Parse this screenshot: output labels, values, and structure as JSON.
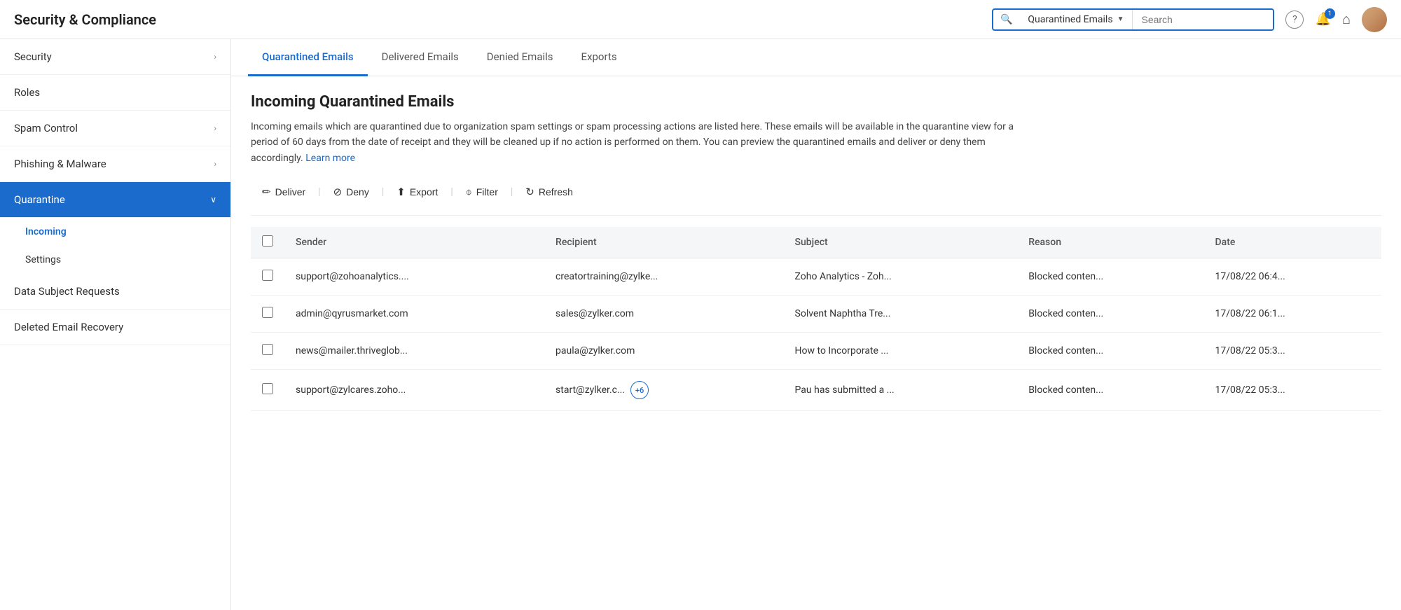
{
  "header": {
    "title": "Security & Compliance",
    "search": {
      "scope": "Quarantined Emails",
      "placeholder": "Search"
    },
    "notification_count": "1",
    "icons": {
      "help": "?",
      "bell": "🔔",
      "home": "⌂"
    }
  },
  "sidebar": {
    "items": [
      {
        "id": "security",
        "label": "Security",
        "hasChevron": true,
        "active": false
      },
      {
        "id": "roles",
        "label": "Roles",
        "hasChevron": false,
        "active": false
      },
      {
        "id": "spam-control",
        "label": "Spam Control",
        "hasChevron": true,
        "active": false
      },
      {
        "id": "phishing-malware",
        "label": "Phishing & Malware",
        "hasChevron": true,
        "active": false
      },
      {
        "id": "quarantine",
        "label": "Quarantine",
        "hasChevron": false,
        "active": true
      }
    ],
    "sub_items": [
      {
        "id": "incoming",
        "label": "Incoming",
        "active": true
      },
      {
        "id": "settings",
        "label": "Settings",
        "active": false
      }
    ],
    "bottom_items": [
      {
        "id": "data-subject",
        "label": "Data Subject Requests",
        "hasChevron": false,
        "active": false
      },
      {
        "id": "deleted-email",
        "label": "Deleted Email Recovery",
        "hasChevron": false,
        "active": false
      }
    ]
  },
  "tabs": [
    {
      "id": "quarantined",
      "label": "Quarantined Emails",
      "active": true
    },
    {
      "id": "delivered",
      "label": "Delivered Emails",
      "active": false
    },
    {
      "id": "denied",
      "label": "Denied Emails",
      "active": false
    },
    {
      "id": "exports",
      "label": "Exports",
      "active": false
    }
  ],
  "content": {
    "title": "Incoming Quarantined Emails",
    "description": "Incoming emails which are quarantined due to organization spam settings or spam processing actions are listed here. These emails will be available in the quarantine view for a period of 60 days from the date of receipt and they will be cleaned up if no action is performed on them. You can preview the quarantined emails and deliver or deny them accordingly.",
    "learn_more": "Learn more",
    "actions": [
      {
        "id": "deliver",
        "label": "Deliver",
        "icon": "✏"
      },
      {
        "id": "deny",
        "label": "Deny",
        "icon": "🚫"
      },
      {
        "id": "export",
        "label": "Export",
        "icon": "⬆"
      },
      {
        "id": "filter",
        "label": "Filter",
        "icon": "⌽"
      },
      {
        "id": "refresh",
        "label": "Refresh",
        "icon": "↻"
      }
    ],
    "table": {
      "columns": [
        "Sender",
        "Recipient",
        "Subject",
        "Reason",
        "Date"
      ],
      "rows": [
        {
          "sender": "support@zohoanalytics....",
          "recipient": "creatortraining@zylke...",
          "recipient_extra": null,
          "subject": "Zoho Analytics - Zoh...",
          "reason": "Blocked conten...",
          "date": "17/08/22 06:4..."
        },
        {
          "sender": "admin@qyrusmarket.com",
          "recipient": "sales@zylker.com",
          "recipient_extra": null,
          "subject": "Solvent Naphtha Tre...",
          "reason": "Blocked conten...",
          "date": "17/08/22 06:1..."
        },
        {
          "sender": "news@mailer.thriveglob...",
          "recipient": "paula@zylker.com",
          "recipient_extra": null,
          "subject": "How to Incorporate ...",
          "reason": "Blocked conten...",
          "date": "17/08/22 05:3..."
        },
        {
          "sender": "support@zylcares.zoho...",
          "recipient": "start@zylker.c...",
          "recipient_extra": "+6",
          "subject": "Pau has submitted a ...",
          "reason": "Blocked conten...",
          "date": "17/08/22 05:3..."
        }
      ]
    }
  }
}
